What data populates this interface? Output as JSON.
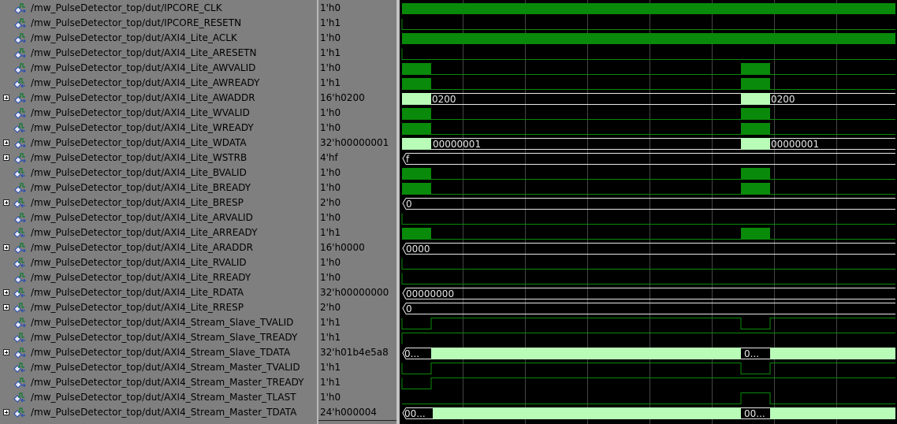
{
  "colors": {
    "pane_bg": "#7f7f7f",
    "wave_bg": "#000000",
    "wave_green": "#0a8a0a",
    "bus_fill": "#b8fcb8",
    "bus_text": "#e8e8e8",
    "grid": "#454545"
  },
  "icons": {
    "signal": "signal-waveform-icon",
    "expand": "expand-plus-icon"
  },
  "signals": [
    {
      "name": "/mw_PulseDetector_top/dut/IPCORE_CLK",
      "value": "1'h0",
      "expandable": false,
      "icon": "in"
    },
    {
      "name": "/mw_PulseDetector_top/dut/IPCORE_RESETN",
      "value": "1'h1",
      "expandable": false,
      "icon": "in"
    },
    {
      "name": "/mw_PulseDetector_top/dut/AXI4_Lite_ACLK",
      "value": "1'h0",
      "expandable": false,
      "icon": "in"
    },
    {
      "name": "/mw_PulseDetector_top/dut/AXI4_Lite_ARESETN",
      "value": "1'h1",
      "expandable": false,
      "icon": "in"
    },
    {
      "name": "/mw_PulseDetector_top/dut/AXI4_Lite_AWVALID",
      "value": "1'h0",
      "expandable": false,
      "icon": "in"
    },
    {
      "name": "/mw_PulseDetector_top/dut/AXI4_Lite_AWREADY",
      "value": "1'h1",
      "expandable": false,
      "icon": "out"
    },
    {
      "name": "/mw_PulseDetector_top/dut/AXI4_Lite_AWADDR",
      "value": "16'h0200",
      "expandable": true,
      "icon": "in"
    },
    {
      "name": "/mw_PulseDetector_top/dut/AXI4_Lite_WVALID",
      "value": "1'h0",
      "expandable": false,
      "icon": "in"
    },
    {
      "name": "/mw_PulseDetector_top/dut/AXI4_Lite_WREADY",
      "value": "1'h0",
      "expandable": false,
      "icon": "out"
    },
    {
      "name": "/mw_PulseDetector_top/dut/AXI4_Lite_WDATA",
      "value": "32'h00000001",
      "expandable": true,
      "icon": "in"
    },
    {
      "name": "/mw_PulseDetector_top/dut/AXI4_Lite_WSTRB",
      "value": "4'hf",
      "expandable": true,
      "icon": "in"
    },
    {
      "name": "/mw_PulseDetector_top/dut/AXI4_Lite_BVALID",
      "value": "1'h0",
      "expandable": false,
      "icon": "out"
    },
    {
      "name": "/mw_PulseDetector_top/dut/AXI4_Lite_BREADY",
      "value": "1'h0",
      "expandable": false,
      "icon": "in"
    },
    {
      "name": "/mw_PulseDetector_top/dut/AXI4_Lite_BRESP",
      "value": "2'h0",
      "expandable": true,
      "icon": "out"
    },
    {
      "name": "/mw_PulseDetector_top/dut/AXI4_Lite_ARVALID",
      "value": "1'h0",
      "expandable": false,
      "icon": "in"
    },
    {
      "name": "/mw_PulseDetector_top/dut/AXI4_Lite_ARREADY",
      "value": "1'h1",
      "expandable": false,
      "icon": "out"
    },
    {
      "name": "/mw_PulseDetector_top/dut/AXI4_Lite_ARADDR",
      "value": "16'h0000",
      "expandable": true,
      "icon": "in"
    },
    {
      "name": "/mw_PulseDetector_top/dut/AXI4_Lite_RVALID",
      "value": "1'h0",
      "expandable": false,
      "icon": "out"
    },
    {
      "name": "/mw_PulseDetector_top/dut/AXI4_Lite_RREADY",
      "value": "1'h0",
      "expandable": false,
      "icon": "in"
    },
    {
      "name": "/mw_PulseDetector_top/dut/AXI4_Lite_RDATA",
      "value": "32'h00000000",
      "expandable": true,
      "icon": "out"
    },
    {
      "name": "/mw_PulseDetector_top/dut/AXI4_Lite_RRESP",
      "value": "2'h0",
      "expandable": true,
      "icon": "out"
    },
    {
      "name": "/mw_PulseDetector_top/dut/AXI4_Stream_Slave_TVALID",
      "value": "1'h1",
      "expandable": false,
      "icon": "in"
    },
    {
      "name": "/mw_PulseDetector_top/dut/AXI4_Stream_Slave_TREADY",
      "value": "1'h1",
      "expandable": false,
      "icon": "out"
    },
    {
      "name": "/mw_PulseDetector_top/dut/AXI4_Stream_Slave_TDATA",
      "value": "32'h01b4e5a8",
      "expandable": true,
      "icon": "in"
    },
    {
      "name": "/mw_PulseDetector_top/dut/AXI4_Stream_Master_TVALID",
      "value": "1'h1",
      "expandable": false,
      "icon": "out"
    },
    {
      "name": "/mw_PulseDetector_top/dut/AXI4_Stream_Master_TREADY",
      "value": "1'h1",
      "expandable": false,
      "icon": "in"
    },
    {
      "name": "/mw_PulseDetector_top/dut/AXI4_Stream_Master_TLAST",
      "value": "1'h0",
      "expandable": false,
      "icon": "out"
    },
    {
      "name": "/mw_PulseDetector_top/dut/AXI4_Stream_Master_TDATA",
      "value": "24'h000004",
      "expandable": true,
      "icon": "out"
    }
  ],
  "bus_labels": {
    "awaddr": [
      "0200",
      "0200"
    ],
    "wdata": [
      "00000001",
      "00000001"
    ],
    "wstrb": "f",
    "bresp": "0",
    "araddr": "0000",
    "rdata": "00000000",
    "rresp": "0",
    "slave_tdata": [
      "0...",
      "0..."
    ],
    "master_tdata": [
      "00...",
      "00..."
    ]
  }
}
